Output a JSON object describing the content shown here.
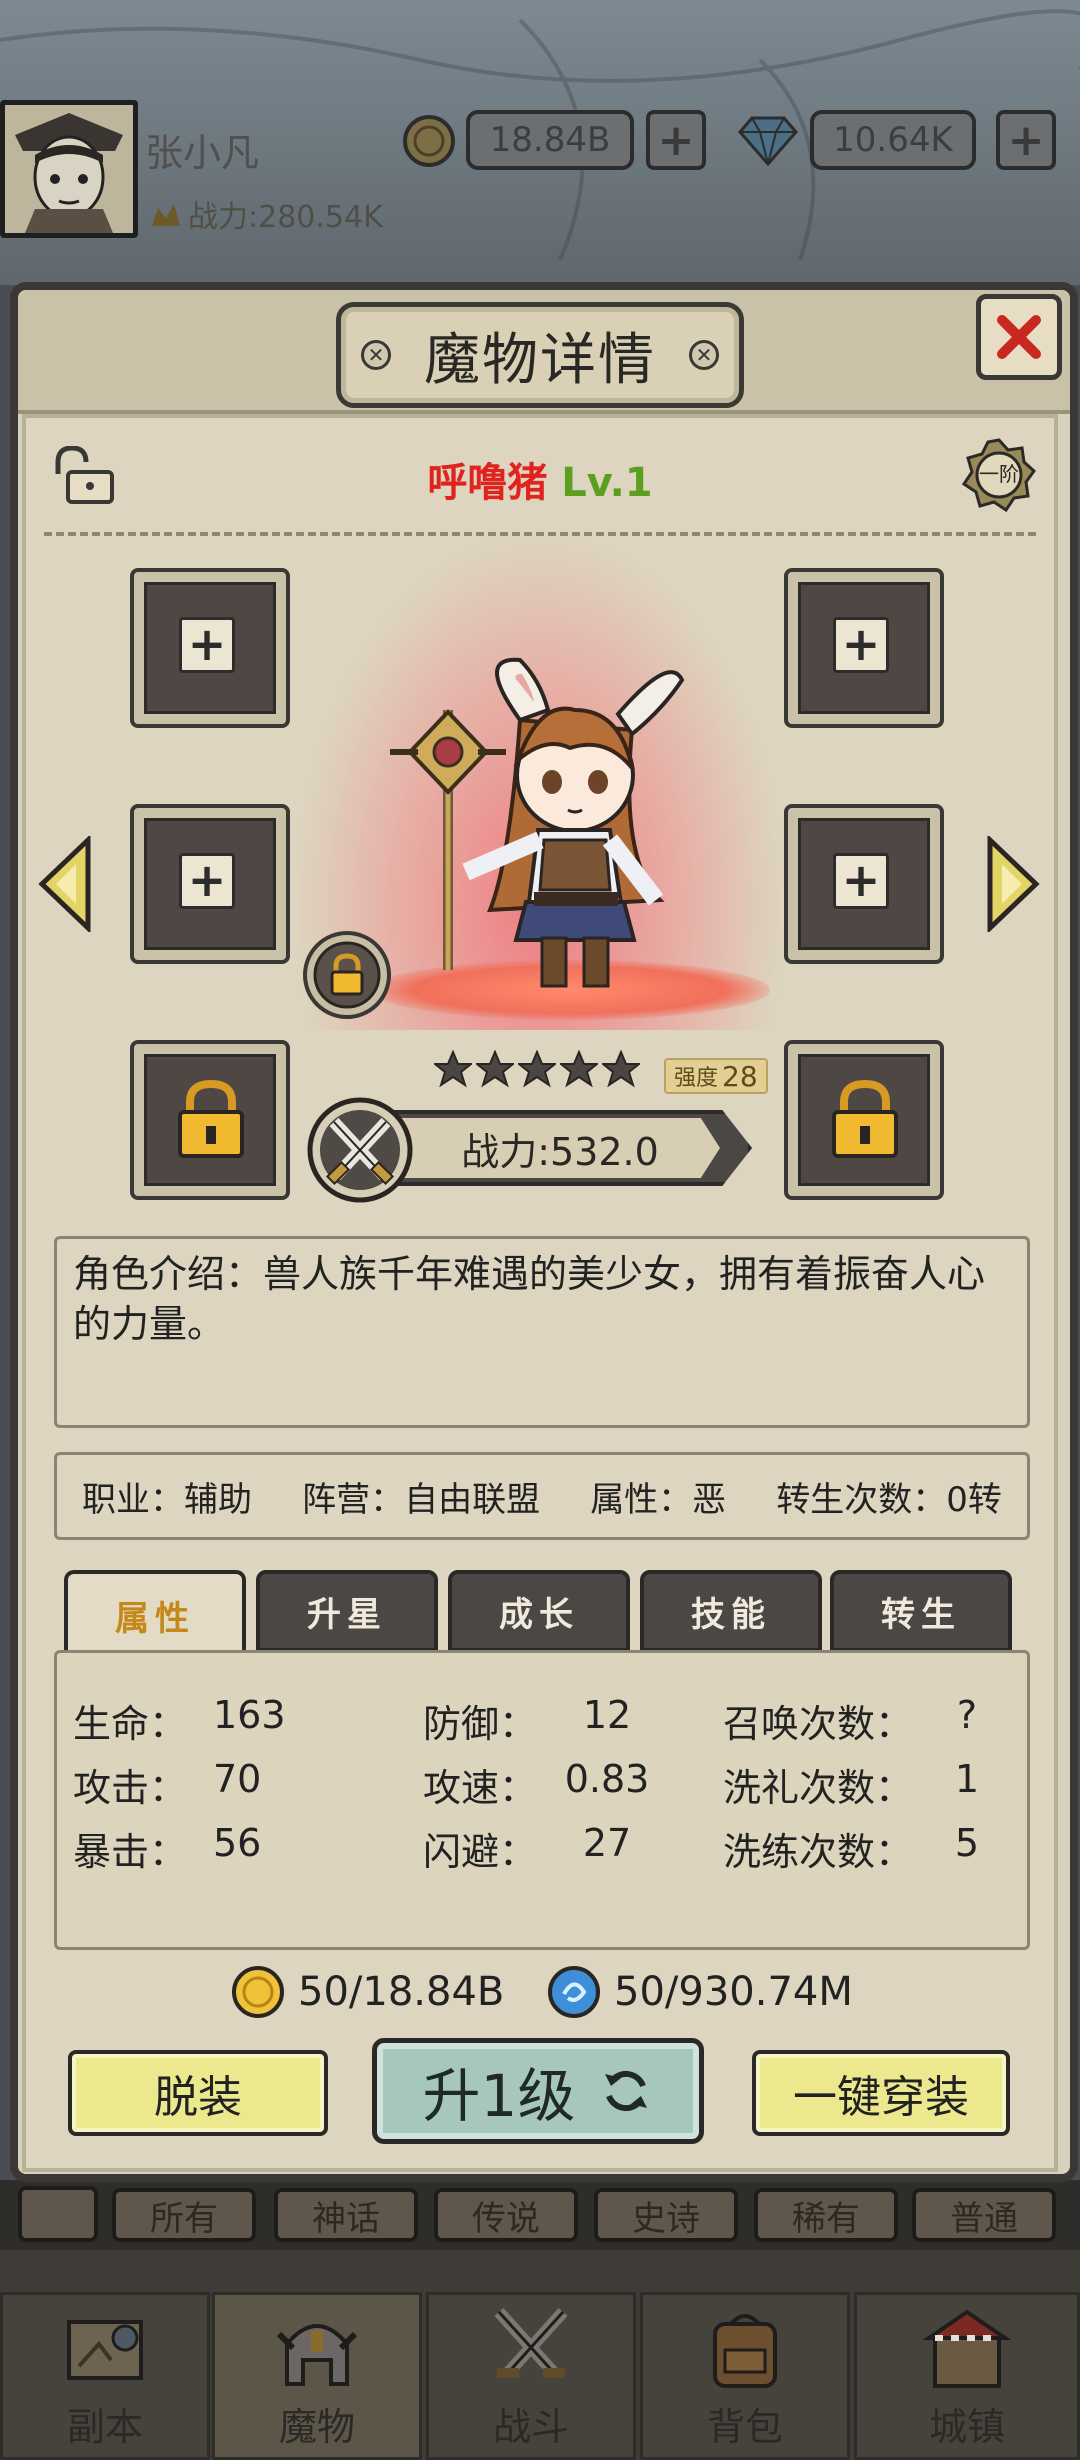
{
  "topbar": {
    "player_name": "张小凡",
    "power": "战力:280.54K",
    "gold": "18.84B",
    "diamond": "10.64K",
    "add_symbol": "+"
  },
  "dialog": {
    "title": "魔物详情",
    "close_symbol": "✕",
    "monster_name": "呼噜猪",
    "monster_level": "Lv.1",
    "rank": "一阶",
    "star_count": 5,
    "strength_label": "强度",
    "strength_value": "28",
    "combat_power": "战力:532.0",
    "description": "角色介绍：兽人族千年难遇的美少女，拥有着振奋人心的力量。",
    "info": {
      "job": "职业：辅助",
      "faction": "阵营：自由联盟",
      "attribute": "属性：恶",
      "rebirth": "转生次数：0转"
    },
    "tabs": [
      "属性",
      "升星",
      "成长",
      "技能",
      "转生"
    ],
    "active_tab": 0,
    "stats": [
      {
        "label": "生命：",
        "value": "163"
      },
      {
        "label": "攻击：",
        "value": "70"
      },
      {
        "label": "暴击：",
        "value": "56"
      },
      {
        "label": "防御：",
        "value": "12"
      },
      {
        "label": "攻速：",
        "value": "0.83"
      },
      {
        "label": "闪避：",
        "value": "27"
      },
      {
        "label": "召唤次数：",
        "value": "?"
      },
      {
        "label": "洗礼次数：",
        "value": "1"
      },
      {
        "label": "洗练次数：",
        "value": "5"
      }
    ],
    "cost_gold": "50/18.84B",
    "cost_crystal": "50/930.74M",
    "buttons": {
      "unequip": "脱装",
      "level_up": "升1级",
      "equip_all": "一键穿装"
    }
  },
  "filter_tabs": [
    "所有",
    "神话",
    "传说",
    "史诗",
    "稀有",
    "普通"
  ],
  "nav": [
    "副本",
    "魔物",
    "战斗",
    "背包",
    "城镇"
  ],
  "colors": {
    "name_red": "#e0231f",
    "level_green": "#5c9e1f",
    "active_tab_text": "#c4891a",
    "button_yellow": "#ebe88d",
    "levelup_teal": "#a7c7be"
  }
}
